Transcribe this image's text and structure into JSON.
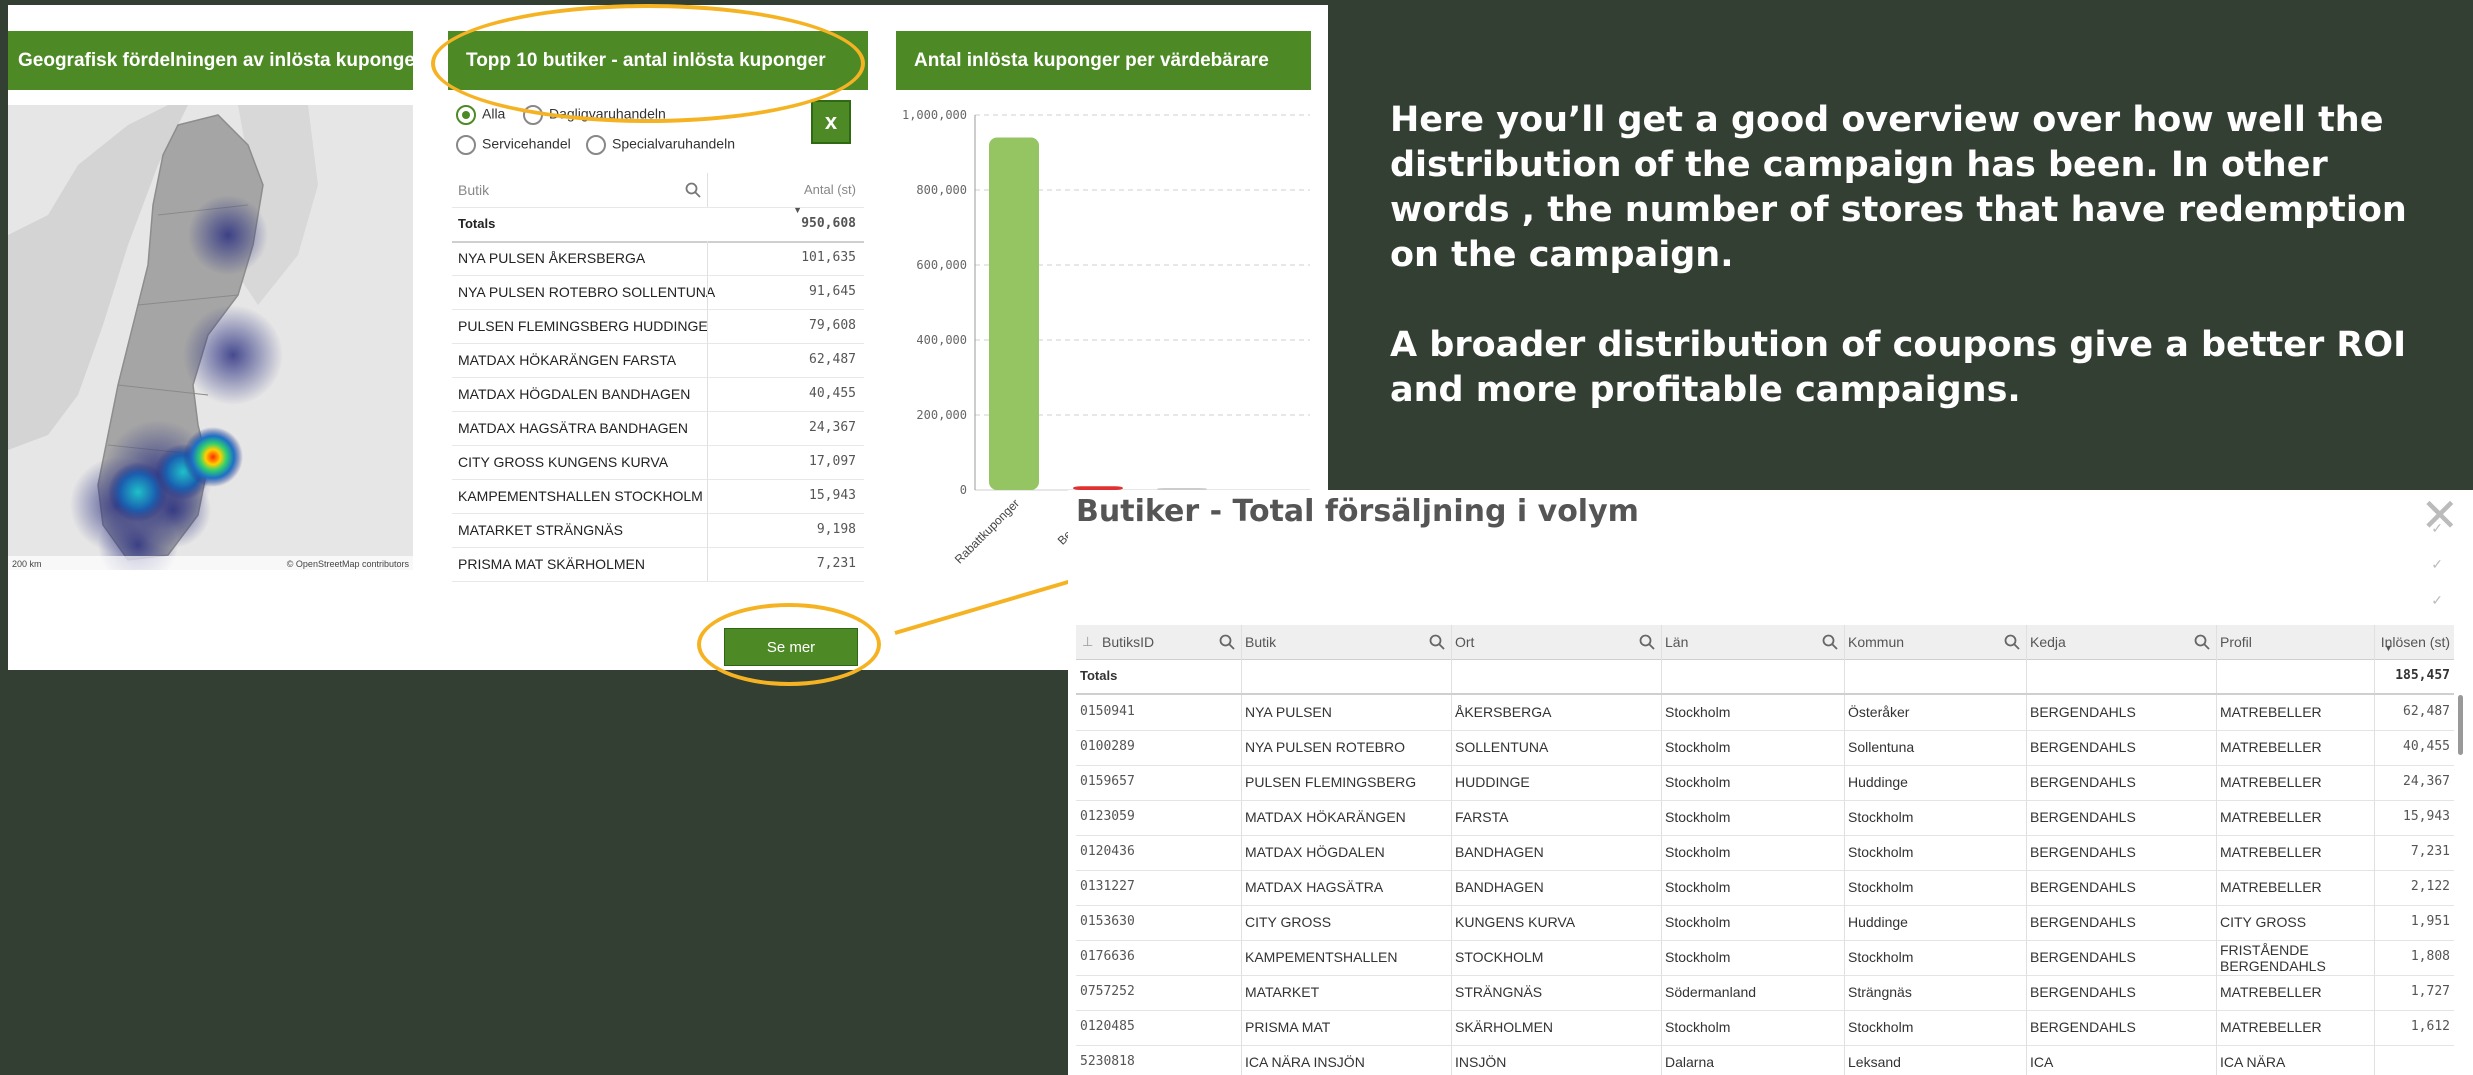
{
  "panels": {
    "map_title": "Geografisk fördelningen av inlösta kuponger",
    "top10_title": "Topp 10 butiker - antal inlösta kuponger",
    "chart_title": "Antal inlösta kuponger per värdebärare"
  },
  "map": {
    "scale_label": "200 km",
    "attribution": "© OpenStreetMap contributors"
  },
  "top10": {
    "filters": [
      "Alla",
      "Dagligvaruhandeln",
      "Servicehandel",
      "Specialvaruhandeln"
    ],
    "selected_filter": "Alla",
    "export_icon": "excel-icon",
    "search_placeholder": "Butik",
    "value_header": "Antal (st)",
    "totals_label": "Totals",
    "totals_value": "950,608",
    "rows": [
      {
        "name": "NYA PULSEN ÅKERSBERGA",
        "value": "101,635"
      },
      {
        "name": "NYA PULSEN ROTEBRO SOLLENTUNA",
        "value": "91,645"
      },
      {
        "name": "PULSEN FLEMINGSBERG HUDDINGE",
        "value": "79,608"
      },
      {
        "name": "MATDAX HÖKARÄNGEN FARSTA",
        "value": "62,487"
      },
      {
        "name": "MATDAX HÖGDALEN BANDHAGEN",
        "value": "40,455"
      },
      {
        "name": "MATDAX HAGSÄTRA BANDHAGEN",
        "value": "24,367"
      },
      {
        "name": "CITY GROSS KUNGENS KURVA",
        "value": "17,097"
      },
      {
        "name": "KAMPEMENTSHALLEN STOCKHOLM",
        "value": "15,943"
      },
      {
        "name": "MATARKET STRÄNGNÄS",
        "value": "9,198"
      },
      {
        "name": "PRISMA MAT SKÄRHOLMEN",
        "value": "7,231"
      }
    ],
    "more_button": "Se mer"
  },
  "chart_data": {
    "type": "bar",
    "categories": [
      "Rabattkuponger",
      "Betalcheck",
      ""
    ],
    "values": [
      940000,
      10000,
      0
    ],
    "bar_colors": [
      "#95c463",
      "#e03030",
      "#cccccc"
    ],
    "ylim": [
      0,
      1000000
    ],
    "yticks": [
      "0",
      "200,000",
      "400,000",
      "600,000",
      "800,000",
      "1,000,000"
    ],
    "grid": true
  },
  "description": {
    "paragraph1": "Here you’ll get a good overview over how well the distribution of the campaign has been. In other words , the number of stores that have redemption on the campaign.",
    "paragraph2": "A broader distribution of coupons give a better ROI and more profitable campaigns."
  },
  "popup": {
    "title": "Butiker - Total försäljning i volym",
    "close_icon": "close-icon",
    "columns": [
      "ButiksID",
      "Butik",
      "Ort",
      "Län",
      "Kommun",
      "Kedja",
      "Profil",
      "Inlösen (st)"
    ],
    "totals_label": "Totals",
    "totals_value": "185,457",
    "rows": [
      [
        "0150941",
        "NYA PULSEN",
        "ÅKERSBERGA",
        "Stockholm",
        "Österåker",
        "BERGENDAHLS",
        "MATREBELLER",
        "62,487"
      ],
      [
        "0100289",
        "NYA PULSEN ROTEBRO",
        "SOLLENTUNA",
        "Stockholm",
        "Sollentuna",
        "BERGENDAHLS",
        "MATREBELLER",
        "40,455"
      ],
      [
        "0159657",
        "PULSEN FLEMINGSBERG",
        "HUDDINGE",
        "Stockholm",
        "Huddinge",
        "BERGENDAHLS",
        "MATREBELLER",
        "24,367"
      ],
      [
        "0123059",
        "MATDAX HÖKARÄNGEN",
        "FARSTA",
        "Stockholm",
        "Stockholm",
        "BERGENDAHLS",
        "MATREBELLER",
        "15,943"
      ],
      [
        "0120436",
        "MATDAX HÖGDALEN",
        "BANDHAGEN",
        "Stockholm",
        "Stockholm",
        "BERGENDAHLS",
        "MATREBELLER",
        "7,231"
      ],
      [
        "0131227",
        "MATDAX HAGSÄTRA",
        "BANDHAGEN",
        "Stockholm",
        "Stockholm",
        "BERGENDAHLS",
        "MATREBELLER",
        "2,122"
      ],
      [
        "0153630",
        "CITY GROSS",
        "KUNGENS KURVA",
        "Stockholm",
        "Huddinge",
        "BERGENDAHLS",
        "CITY GROSS",
        "1,951"
      ],
      [
        "0176636",
        "KAMPEMENTSHALLEN",
        "STOCKHOLM",
        "Stockholm",
        "Stockholm",
        "BERGENDAHLS",
        "FRISTÅENDE BERGENDAHLS",
        "1,808"
      ],
      [
        "0757252",
        "MATARKET",
        "STRÄNGNÄS",
        "Södermanland",
        "Strängnäs",
        "BERGENDAHLS",
        "MATREBELLER",
        "1,727"
      ],
      [
        "0120485",
        "PRISMA MAT",
        "SKÄRHOLMEN",
        "Stockholm",
        "Stockholm",
        "BERGENDAHLS",
        "MATREBELLER",
        "1,612"
      ],
      [
        "5230818",
        "ICA NÄRA INSJÖN",
        "INSJÖN",
        "Dalarna",
        "Leksand",
        "ICA",
        "ICA NÄRA",
        ""
      ]
    ]
  }
}
